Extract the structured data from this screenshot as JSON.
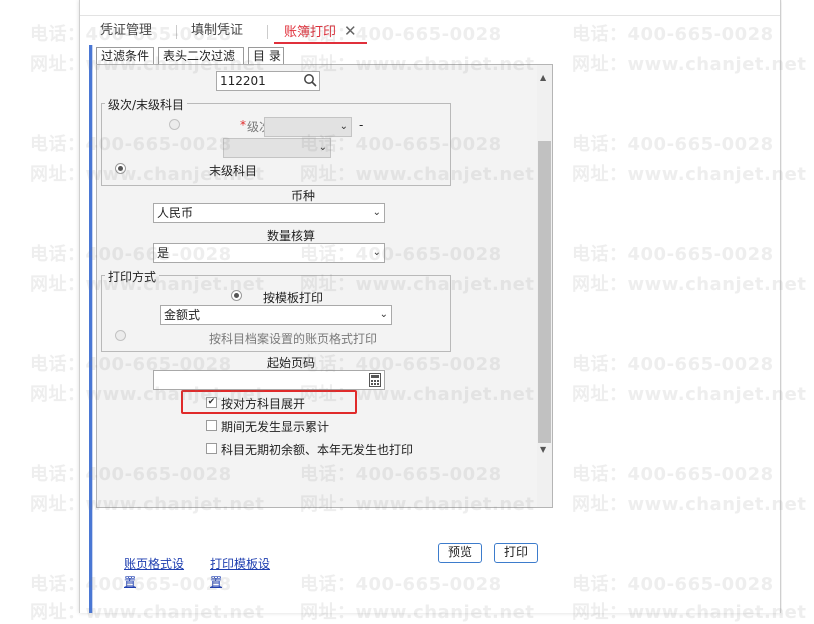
{
  "tabs": [
    {
      "label": "凭证管理"
    },
    {
      "label": "填制凭证"
    },
    {
      "label": "账簿打印",
      "close": "✕"
    }
  ],
  "subtabs": [
    "过滤条件",
    "表头二次过滤",
    "目 录"
  ],
  "filter": {
    "account_code": "112201",
    "level_group": {
      "title": "级次/末级科目",
      "required_mark": "*",
      "level_label": "级次",
      "dash": "-",
      "last_level_label": "末级科目"
    },
    "currency": {
      "label": "币种",
      "value": "人民币"
    },
    "quantity": {
      "label": "数量核算",
      "value": "是"
    },
    "print_group": {
      "title": "打印方式",
      "template_label": "按模板打印",
      "template_value": "金额式",
      "archive_label": "按科目档案设置的账页格式打印"
    },
    "start_page": {
      "label": "起始页码",
      "value": ""
    },
    "options": [
      {
        "label": "按对方科目展开",
        "checked": true
      },
      {
        "label": "期间无发生显示累计",
        "checked": false
      },
      {
        "label": "科目无期初余额、本年无发生也打印",
        "checked": false
      }
    ]
  },
  "footer": {
    "link1": "账页格式设置",
    "link2": "打印模板设置",
    "preview_button": "预览",
    "print_button": "打印"
  },
  "watermark": {
    "phone": "电话：400-665-0028",
    "site": "网址：www.chanjet.net"
  },
  "colors": {
    "accent": "#e0303b",
    "link": "#1f3fb0",
    "highlight": "#e02a2a",
    "side_bar": "#4a77d4"
  }
}
